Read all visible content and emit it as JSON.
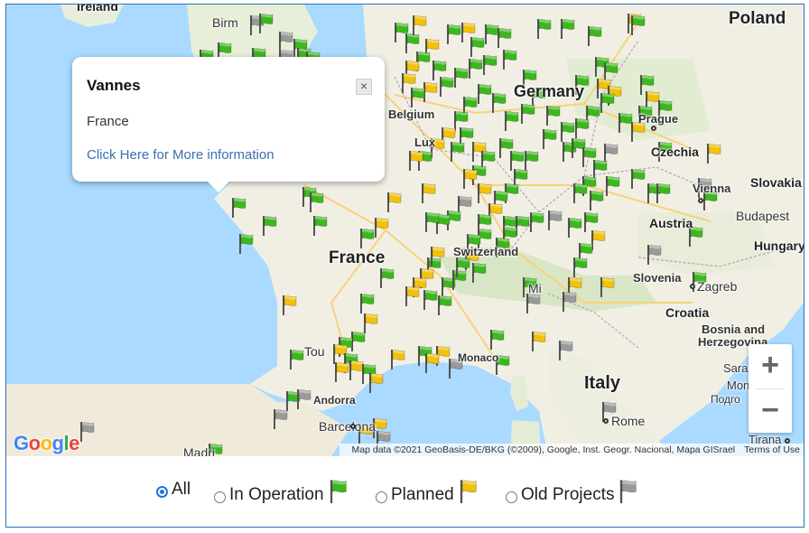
{
  "map": {
    "countries": [
      "Ireland",
      "Poland",
      "Germany",
      "Belgium",
      "Luxembourg",
      "Czechia",
      "Slovakia",
      "Austria",
      "Budapest",
      "Hungary",
      "France",
      "Switzerland",
      "Slovenia",
      "Zagreb",
      "Croatia",
      "Bosnia and Herzegovina",
      "Sarajevo",
      "Italy",
      "Monaco",
      "Andorra",
      "Barcelona",
      "Rome",
      "Tirana",
      "Toulouse",
      "Prague",
      "Vienna",
      "Birmingham"
    ],
    "labels": {
      "ireland": "Ireland",
      "poland": "Poland",
      "germany": "Germany",
      "belgium": "Belgium",
      "luxembourg": "Lux",
      "czechia": "Czechia",
      "slovakia": "Slovakia",
      "austria": "Austria",
      "budapest": "Budapest",
      "hungary": "Hungary",
      "france": "France",
      "switzerland": "Switzerland",
      "slovenia": "Slovenia",
      "zagreb": "Zagreb",
      "croatia": "Croatia",
      "bosnia1": "Bosnia and",
      "bosnia2": "Herzegovina",
      "sarajevo": "Sara",
      "italy": "Italy",
      "monaco": "Monaco",
      "andorra": "Andorra",
      "barcelona": "Barcelona",
      "rome": "Rome",
      "tirana": "Tirana",
      "toulouse": "Tou",
      "prague": "Prague",
      "vienna": "Vienna",
      "birmingham": "Birm",
      "mon": "Mon",
      "podgorica": "Подго",
      "madrid": "Madri",
      "milan": "Mi"
    },
    "flag_colors": {
      "operation": "#3cb81e",
      "planned": "#f2c10c",
      "old": "#9a9a9a"
    },
    "google_logo": "Google",
    "attribution": "Map data ©2021 GeoBasis-DE/BKG (©2009), Google, Inst. Geogr. Nacional, Mapa GISrael",
    "terms": "Terms of Use",
    "zoom_in": "+",
    "zoom_out": "−"
  },
  "popup": {
    "title": "Vannes",
    "country": "France",
    "link": "Click Here for More information",
    "close": "×"
  },
  "filters": [
    {
      "label": "All",
      "checked": true,
      "flag": null
    },
    {
      "label": "In Operation",
      "checked": false,
      "flag": "operation"
    },
    {
      "label": "Planned",
      "checked": false,
      "flag": "planned"
    },
    {
      "label": "Old Projects",
      "checked": false,
      "flag": "old"
    }
  ]
}
